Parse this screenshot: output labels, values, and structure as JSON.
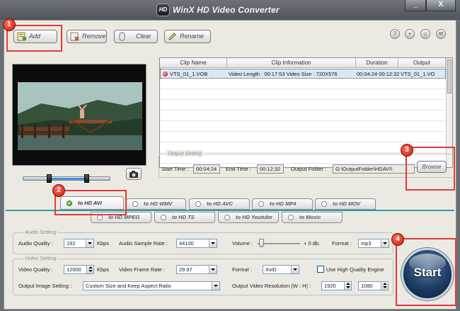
{
  "window": {
    "title": "WinX HD Video Converter",
    "logo_text": "HD",
    "minimize_label": "_",
    "close_label": "X"
  },
  "toolbar": {
    "add_label": "Add",
    "remove_label": "Remove",
    "clear_label": "Clear",
    "rename_label": "Rename"
  },
  "header_icons": [
    "help-icon",
    "user-icon",
    "home-icon",
    "email-icon"
  ],
  "clip_table": {
    "columns": [
      "Clip Name",
      "Clip Information",
      "Duration",
      "Output"
    ],
    "rows": [
      {
        "name": "VTS_01_1.VOB",
        "info": "Video Length : 00:17:53  Video Size : 720X576",
        "duration": "00:04:24 00:12:32",
        "output": "VTS_01_1.VO"
      }
    ]
  },
  "output_setting": {
    "legend": "Output Setting",
    "start_time_label": "Start Time :",
    "start_time": "00:04:24",
    "end_time_label": "End Time :",
    "end_time": "00:12:32",
    "folder_label": "Output Folder :",
    "folder": "G:\\OutputFolder\\HDAVI\\",
    "browse_label": "Browse"
  },
  "tabs_row1": [
    "to HD AVI",
    "to HD WMV",
    "to HD AVC",
    "to HD MP4",
    "to HD MOV"
  ],
  "tabs_row2": [
    "to HD MPEG",
    "to HD TS",
    "to HD Youtube",
    "to Music"
  ],
  "audio_setting": {
    "legend": "Audio Setting",
    "quality_label": "Audio Quality :",
    "quality": "192",
    "quality_unit": "Kbps",
    "sample_rate_label": "Audio Sample Rate :",
    "sample_rate": "44100",
    "volume_label": "Volume :",
    "volume_value": "+ 0 db.",
    "format_label": "Format :",
    "format": "mp3"
  },
  "video_setting": {
    "legend": "Video Setting",
    "quality_label": "Video Quality :",
    "quality": "12000",
    "quality_unit": "Kbps",
    "frame_rate_label": "Video Frame Rate :",
    "frame_rate": "29.97",
    "format_label": "Format :",
    "format": "XviD",
    "hq_label": "Use High Quality Engine",
    "image_setting_label": "Output Image Setting :",
    "image_setting": "Custom Size and Keep Aspect Ratio",
    "resolution_label": "Output Video Resolution (W : H) :",
    "width": "1920",
    "height": "1080"
  },
  "start_label": "Start",
  "annotations": [
    "1",
    "2",
    "3",
    "4"
  ],
  "colors": {
    "accent_tab_rule": "#2f9ca8",
    "annotation_red": "#e23a3a",
    "start_blue": "#1c3c62"
  }
}
